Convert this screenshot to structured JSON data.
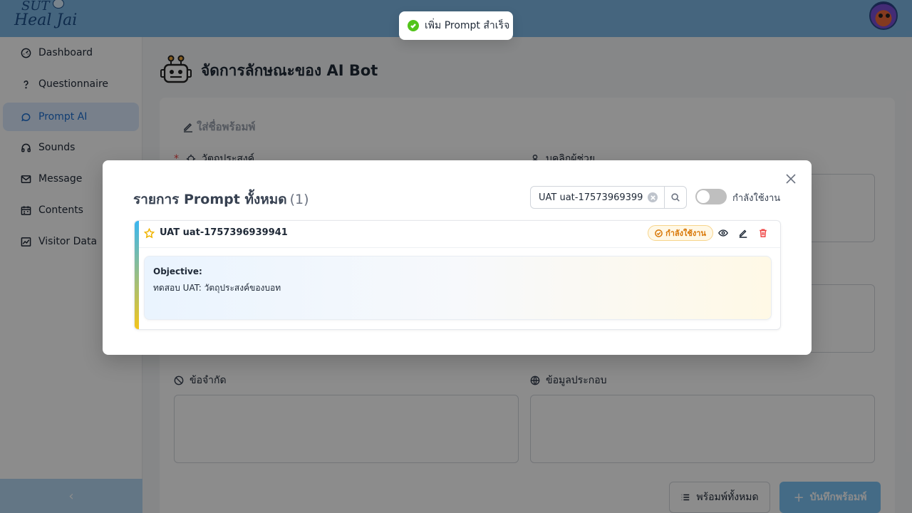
{
  "header": {
    "logo_line1": "SUT",
    "logo_line2": "Heal Jai"
  },
  "sidebar": {
    "items": [
      {
        "label": "Dashboard",
        "icon": "dashboard-icon"
      },
      {
        "label": "Questionnaire",
        "icon": "question-icon"
      },
      {
        "label": "Prompt AI",
        "icon": "chat-icon",
        "active": true
      },
      {
        "label": "Sounds",
        "icon": "headphones-icon"
      },
      {
        "label": "Message",
        "icon": "mail-icon"
      },
      {
        "label": "Contents",
        "icon": "calendar-icon"
      },
      {
        "label": "Visitor Data",
        "icon": "line-chart-icon"
      }
    ],
    "collapse_glyph": "‹"
  },
  "main": {
    "title": "จัดการลักษณะของ AI Bot",
    "name_placeholder": "ใส่ชื่อพร้อมพ์",
    "fields": {
      "objective": "วัตถุประสงค์",
      "persona": "บุคลิกผู้ช่วย",
      "constraints": "ข้อจำกัด",
      "context": "ข้อมูลประกอบ"
    },
    "btn_all": "พร้อมพ์ทั้งหมด",
    "btn_save": "บันทึกพร้อมพ์"
  },
  "toast": {
    "message": "เพิ่ม Prompt สำเร็จ"
  },
  "modal": {
    "title": "รายการ Prompt ทั้งหมด",
    "count": "(1)",
    "search_value": "UAT uat-17573969399",
    "toggle_label": "กำลังใช้งาน",
    "items": [
      {
        "name": "UAT uat-1757396939941",
        "badge": "กำลังใช้งาน",
        "objective_label": "Objective:",
        "objective_text": "ทดสอบ UAT: วัตถุประสงค์ของบอท"
      }
    ]
  },
  "colors": {
    "header": "#7fb9e6",
    "active_item_bg": "#dbeafe",
    "accent": "#1d6fd1",
    "badge": "#d97706",
    "success": "#52c41a",
    "danger": "#ef4444"
  }
}
